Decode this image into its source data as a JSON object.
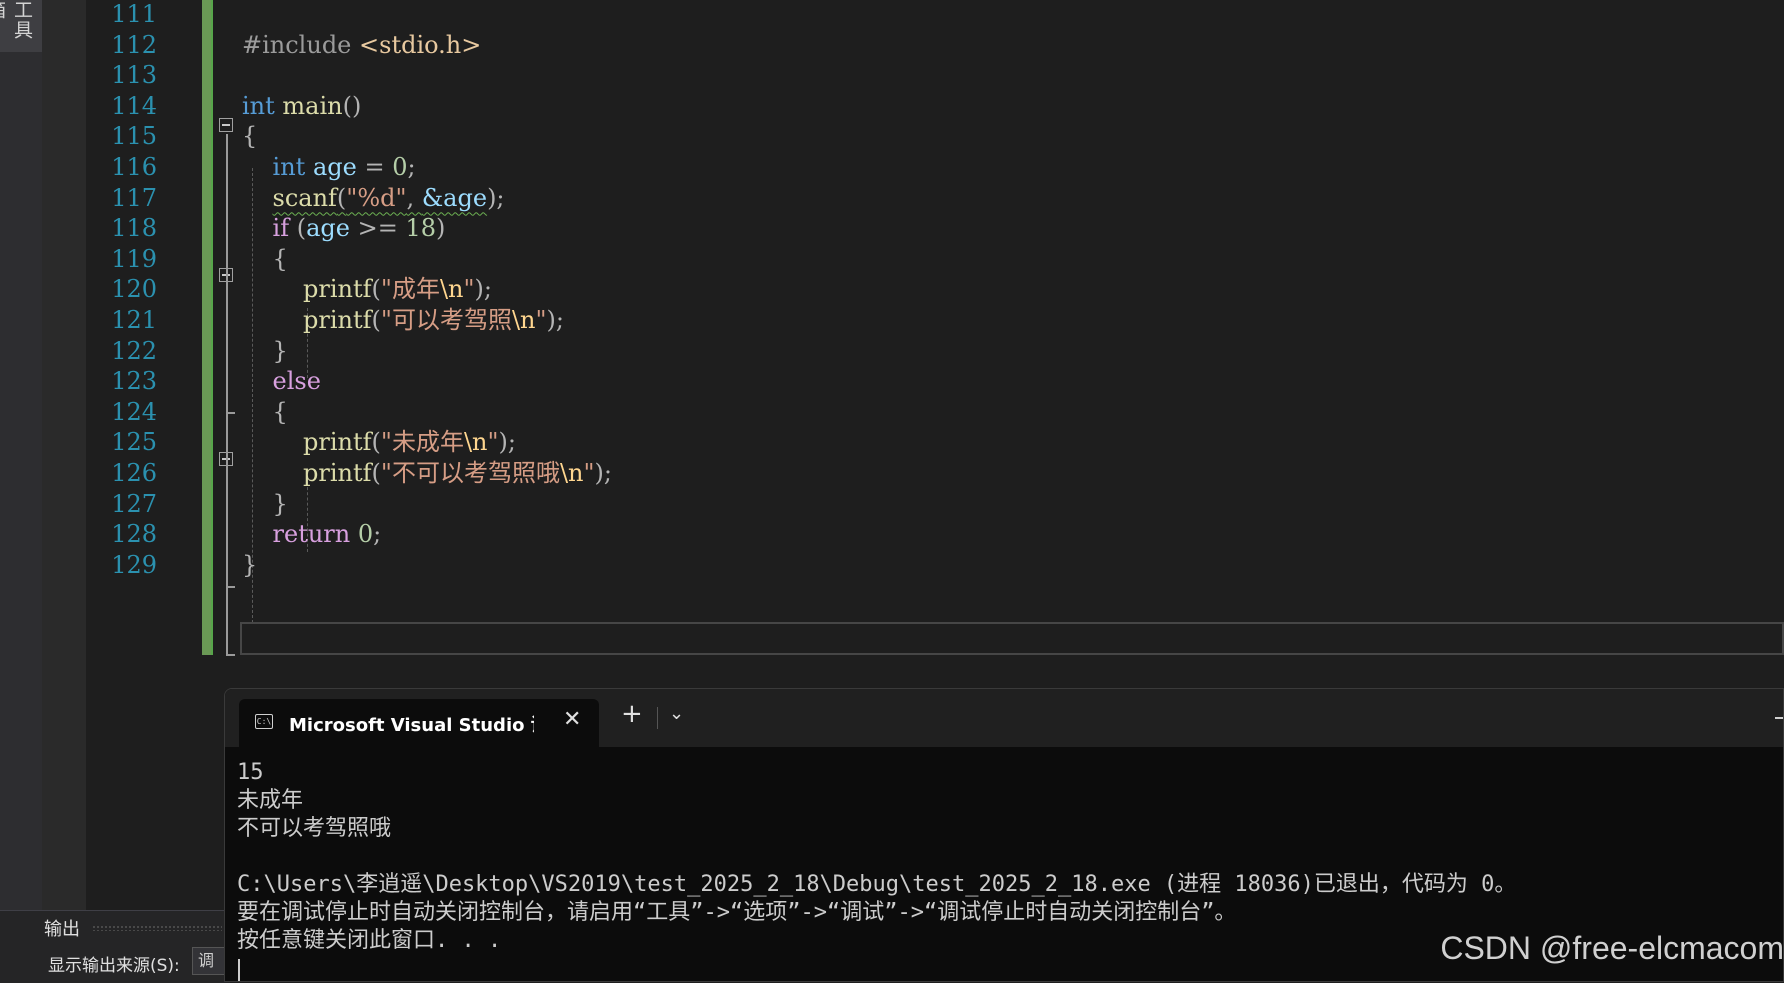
{
  "toolbox": {
    "label": "工具箱"
  },
  "editor": {
    "lines": [
      {
        "number": "111",
        "parts": []
      },
      {
        "number": "112",
        "parts": [
          {
            "text": "#include ",
            "cls": "pp"
          },
          {
            "text": "<stdio.h>",
            "cls": "inc"
          }
        ]
      },
      {
        "number": "113",
        "parts": []
      },
      {
        "number": "114",
        "parts": [
          {
            "text": "int",
            "cls": "kw"
          },
          {
            "text": " ",
            "cls": ""
          },
          {
            "text": "main",
            "cls": "fn"
          },
          {
            "text": "()",
            "cls": "op"
          }
        ]
      },
      {
        "number": "115",
        "parts": [
          {
            "text": "{",
            "cls": "op"
          }
        ]
      },
      {
        "number": "116",
        "parts": [
          {
            "text": "    ",
            "cls": ""
          },
          {
            "text": "int",
            "cls": "kw"
          },
          {
            "text": " ",
            "cls": ""
          },
          {
            "text": "age",
            "cls": "var"
          },
          {
            "text": " = ",
            "cls": "op"
          },
          {
            "text": "0",
            "cls": "num"
          },
          {
            "text": ";",
            "cls": "op"
          }
        ]
      },
      {
        "number": "117",
        "parts": [
          {
            "text": "    ",
            "cls": ""
          },
          {
            "text": "scanf",
            "cls": "fn squig"
          },
          {
            "text": "(",
            "cls": "op squig"
          },
          {
            "text": "\"%d\"",
            "cls": "str squig"
          },
          {
            "text": ", ",
            "cls": "op squig"
          },
          {
            "text": "&age",
            "cls": "var squig"
          },
          {
            "text": ");",
            "cls": "op"
          }
        ]
      },
      {
        "number": "118",
        "parts": [
          {
            "text": "    ",
            "cls": ""
          },
          {
            "text": "if",
            "cls": "kw2"
          },
          {
            "text": " (",
            "cls": "op"
          },
          {
            "text": "age",
            "cls": "var"
          },
          {
            "text": " >= ",
            "cls": "op"
          },
          {
            "text": "18",
            "cls": "num"
          },
          {
            "text": ")",
            "cls": "op"
          }
        ]
      },
      {
        "number": "119",
        "parts": [
          {
            "text": "    {",
            "cls": "op"
          }
        ]
      },
      {
        "number": "120",
        "parts": [
          {
            "text": "        ",
            "cls": ""
          },
          {
            "text": "printf",
            "cls": "fn"
          },
          {
            "text": "(",
            "cls": "op"
          },
          {
            "text": "\"成年",
            "cls": "str"
          },
          {
            "text": "\\n",
            "cls": "esc"
          },
          {
            "text": "\"",
            "cls": "str"
          },
          {
            "text": ");",
            "cls": "op"
          }
        ]
      },
      {
        "number": "121",
        "parts": [
          {
            "text": "        ",
            "cls": ""
          },
          {
            "text": "printf",
            "cls": "fn"
          },
          {
            "text": "(",
            "cls": "op"
          },
          {
            "text": "\"可以考驾照",
            "cls": "str"
          },
          {
            "text": "\\n",
            "cls": "esc"
          },
          {
            "text": "\"",
            "cls": "str"
          },
          {
            "text": ");",
            "cls": "op"
          }
        ]
      },
      {
        "number": "122",
        "parts": [
          {
            "text": "    }",
            "cls": "op"
          }
        ]
      },
      {
        "number": "123",
        "parts": [
          {
            "text": "    ",
            "cls": ""
          },
          {
            "text": "else",
            "cls": "kw2"
          }
        ]
      },
      {
        "number": "124",
        "parts": [
          {
            "text": "    {",
            "cls": "op"
          }
        ]
      },
      {
        "number": "125",
        "parts": [
          {
            "text": "        ",
            "cls": ""
          },
          {
            "text": "printf",
            "cls": "fn"
          },
          {
            "text": "(",
            "cls": "op"
          },
          {
            "text": "\"未成年",
            "cls": "str"
          },
          {
            "text": "\\n",
            "cls": "esc"
          },
          {
            "text": "\"",
            "cls": "str"
          },
          {
            "text": ");",
            "cls": "op"
          }
        ]
      },
      {
        "number": "126",
        "parts": [
          {
            "text": "        ",
            "cls": ""
          },
          {
            "text": "printf",
            "cls": "fn"
          },
          {
            "text": "(",
            "cls": "op"
          },
          {
            "text": "\"不可以考驾照哦",
            "cls": "str"
          },
          {
            "text": "\\n",
            "cls": "esc"
          },
          {
            "text": "\"",
            "cls": "str"
          },
          {
            "text": ");",
            "cls": "op"
          }
        ]
      },
      {
        "number": "127",
        "parts": [
          {
            "text": "    }",
            "cls": "op"
          }
        ]
      },
      {
        "number": "128",
        "parts": [
          {
            "text": "    ",
            "cls": ""
          },
          {
            "text": "return",
            "cls": "kw2"
          },
          {
            "text": " ",
            "cls": ""
          },
          {
            "text": "0",
            "cls": "num"
          },
          {
            "text": ";",
            "cls": "op"
          }
        ]
      },
      {
        "number": "129",
        "parts": [
          {
            "text": "}",
            "cls": "op"
          }
        ]
      }
    ]
  },
  "output_panel": {
    "title": "输出",
    "source_label": "显示输出来源(S):",
    "source_value": "调试"
  },
  "terminal": {
    "tab_title": "Microsoft Visual Studio 调试控制台",
    "tab_icon_text": "C:\\",
    "close_glyph": "✕",
    "new_tab_glyph": "+",
    "dropdown_glyph": "⌄",
    "lines": [
      "15",
      "未成年",
      "不可以考驾照哦",
      "",
      "C:\\Users\\李逍遥\\Desktop\\VS2019\\test_2025_2_18\\Debug\\test_2025_2_18.exe (进程 18036)已退出，代码为 0。",
      "要在调试停止时自动关闭控制台，请启用“工具”->“选项”->“调试”->“调试停止时自动关闭控制台”。",
      "按任意键关闭此窗口. . ."
    ]
  },
  "watermark": "CSDN @free-elcmacom"
}
